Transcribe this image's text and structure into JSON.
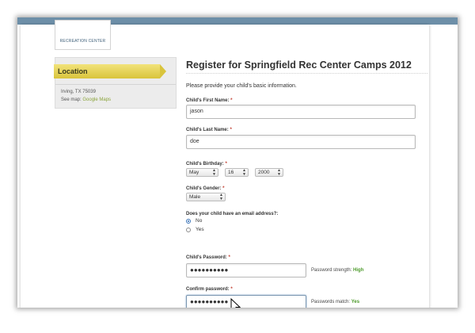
{
  "logo": {
    "text": "RECREATION CENTER"
  },
  "sidebar": {
    "location_title": "Location",
    "address": "Irving, TX 75039",
    "see_map_prefix": "See map:",
    "map_link": "Google Maps"
  },
  "form": {
    "title": "Register for Springfield Rec Center Camps 2012",
    "intro": "Please provide your child's basic information.",
    "required_mark": "*",
    "first_name": {
      "label": "Child's First Name:",
      "value": "jason"
    },
    "last_name": {
      "label": "Child's Last Name:",
      "value": "doe"
    },
    "birthday": {
      "label": "Child's Birthday:",
      "month": "May",
      "day": "16",
      "year": "2000"
    },
    "gender": {
      "label": "Child's Gender:",
      "value": "Male"
    },
    "email_question": {
      "label": "Does your child have an email address?:",
      "options": [
        "No",
        "Yes"
      ],
      "selected": "No"
    },
    "password": {
      "label": "Child's Password:",
      "value": "●●●●●●●●●●",
      "strength_label": "Password strength:",
      "strength_value": "High"
    },
    "confirm_password": {
      "label": "Confirm password:",
      "value": "●●●●●●●●●●",
      "match_label": "Passwords match:",
      "match_value": "Yes"
    }
  },
  "colors": {
    "accent_yellow": "#d9c43c",
    "link_green": "#8aa33a",
    "success_green": "#4c9a2a",
    "header_blue": "#6d8fa8"
  },
  "icons": {
    "cursor": "mouse-pointer-icon",
    "select_arrow": "up-down-arrows-icon"
  }
}
